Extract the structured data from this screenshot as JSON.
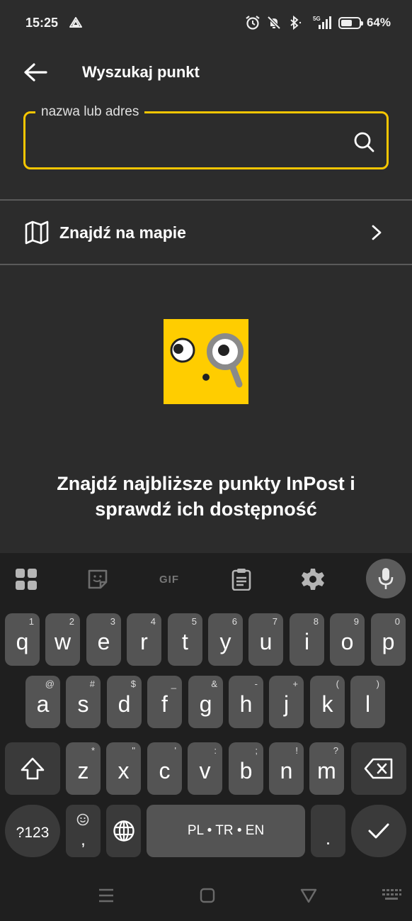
{
  "status_bar": {
    "time": "15:25",
    "battery": "64%",
    "network": "5G"
  },
  "header": {
    "title": "Wyszukaj punkt",
    "back_icon": "arrow-left-icon"
  },
  "search": {
    "label": "nazwa lub adres",
    "value": "",
    "icon": "search-icon"
  },
  "map_row": {
    "label": "Znajdź na mapie",
    "icon": "map-icon"
  },
  "promo": {
    "line1": "Znajdź najbliższe punkty InPost i",
    "line2": "sprawdź ich dostępność"
  },
  "colors": {
    "background": "#2c2c2c",
    "accent": "#f7c600",
    "keyboard": "#1f1f1f"
  },
  "keyboard": {
    "toolbar": [
      "apps-grid-icon",
      "sticker-icon",
      "GIF",
      "clipboard-icon",
      "gear-icon",
      "mic-icon"
    ],
    "gif_label": "GIF",
    "row1": [
      {
        "k": "q",
        "h": "1"
      },
      {
        "k": "w",
        "h": "2"
      },
      {
        "k": "e",
        "h": "3"
      },
      {
        "k": "r",
        "h": "4"
      },
      {
        "k": "t",
        "h": "5"
      },
      {
        "k": "y",
        "h": "6"
      },
      {
        "k": "u",
        "h": "7"
      },
      {
        "k": "i",
        "h": "8"
      },
      {
        "k": "o",
        "h": "9"
      },
      {
        "k": "p",
        "h": "0"
      }
    ],
    "row2": [
      {
        "k": "a",
        "h": "@"
      },
      {
        "k": "s",
        "h": "#"
      },
      {
        "k": "d",
        "h": "$"
      },
      {
        "k": "f",
        "h": "_"
      },
      {
        "k": "g",
        "h": "&"
      },
      {
        "k": "h",
        "h": "-"
      },
      {
        "k": "j",
        "h": "+"
      },
      {
        "k": "k",
        "h": "("
      },
      {
        "k": "l",
        "h": ")"
      }
    ],
    "row3": [
      {
        "k": "z",
        "h": "*"
      },
      {
        "k": "x",
        "h": "\""
      },
      {
        "k": "c",
        "h": "'"
      },
      {
        "k": "v",
        "h": ":"
      },
      {
        "k": "b",
        "h": ";"
      },
      {
        "k": "n",
        "h": "!"
      },
      {
        "k": "m",
        "h": "?"
      }
    ],
    "symbols_label": "?123",
    "comma_label": ",",
    "space_label": "PL • TR • EN",
    "period_label": "."
  }
}
